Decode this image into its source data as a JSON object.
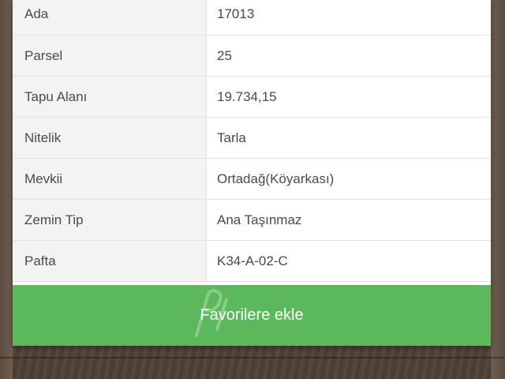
{
  "parcel_info": {
    "rows": [
      {
        "label": "Ada",
        "value": "17013"
      },
      {
        "label": "Parsel",
        "value": "25"
      },
      {
        "label": "Tapu Alanı",
        "value": "19.734,15"
      },
      {
        "label": "Nitelik",
        "value": "Tarla"
      },
      {
        "label": "Mevkii",
        "value": "Ortadağ(Köyarkası)"
      },
      {
        "label": "Zemin Tip",
        "value": "Ana Taşınmaz"
      },
      {
        "label": "Pafta",
        "value": "K34-A-02-C"
      }
    ]
  },
  "actions": {
    "favorite_label": "Favorilere ekle"
  },
  "colors": {
    "button_green": "#5cb85c",
    "label_bg": "#f3f3f3",
    "text": "#4a4a4a"
  }
}
